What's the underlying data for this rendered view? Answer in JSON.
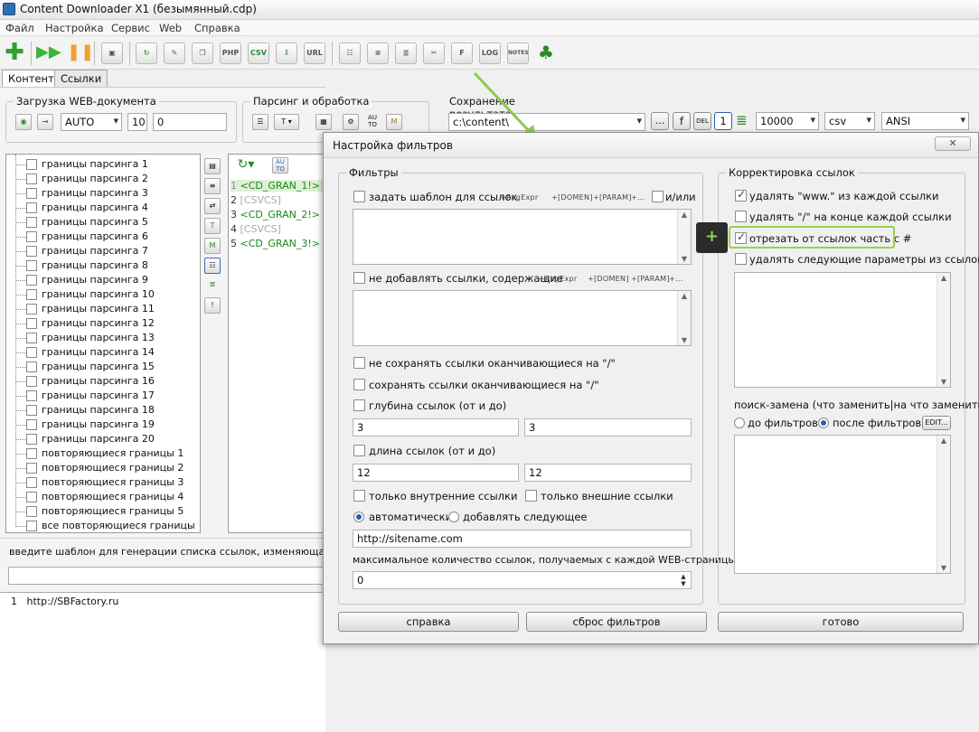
{
  "window": {
    "title": "Content Downloader X1 (безымянный.cdp)"
  },
  "menu": [
    "Файл",
    "Настройка",
    "Сервис",
    "Web",
    "Справка"
  ],
  "toolbar": {
    "icon_labels": [
      "PHP",
      "CSV",
      "URL",
      "LOG",
      "NOTES"
    ]
  },
  "tabs": [
    {
      "label": "Контент"
    },
    {
      "label": "Ссылки"
    }
  ],
  "load_group": {
    "title": "Загрузка WEB-документа",
    "mode": "AUTO",
    "threads": "10",
    "delay": "0"
  },
  "parse_group": {
    "title": "Парсинг и обработка"
  },
  "save_group": {
    "title": "Сохранение результата",
    "path": "c:\\content\\",
    "browse_label": "...",
    "f_label": "f",
    "del_label": "DEL",
    "one_label": "1",
    "limit": "10000",
    "format": "csv",
    "encoding": "ANSI"
  },
  "tree": {
    "items": [
      "границы парсинга 1",
      "границы парсинга 2",
      "границы парсинга 3",
      "границы парсинга 4",
      "границы парсинга 5",
      "границы парсинга 6",
      "границы парсинга 7",
      "границы парсинга 8",
      "границы парсинга 9",
      "границы парсинга 10",
      "границы парсинга 11",
      "границы парсинга 12",
      "границы парсинга 13",
      "границы парсинга 14",
      "границы парсинга 15",
      "границы парсинга 16",
      "границы парсинга 17",
      "границы парсинга 18",
      "границы парсинга 19",
      "границы парсинга 20",
      "повторяющиеся границы 1",
      "повторяющиеся границы 2",
      "повторяющиеся границы 3",
      "повторяющиеся границы 4",
      "повторяющиеся границы 5",
      "все повторяющиеся границы"
    ]
  },
  "code": {
    "auto_label": "AU TO",
    "lines": [
      {
        "n": "1",
        "text": "<CD_GRAN_1!> (",
        "c": "#1a8a1a"
      },
      {
        "n": "2",
        "text": "[CSVCS]",
        "c": "#aaaaaa"
      },
      {
        "n": "3",
        "text": "<CD_GRAN_2!> (",
        "c": "#1a8a1a"
      },
      {
        "n": "4",
        "text": "[CSVCS]",
        "c": "#aaaaaa"
      },
      {
        "n": "5",
        "text": "<CD_GRAN_3!> (",
        "c": "#1a8a1a"
      }
    ]
  },
  "vtools": {
    "t_label": "T",
    "m_label": "M",
    "bang_label": "!"
  },
  "parse_tools": {
    "t_label": "T",
    "au_label": "AU TO",
    "m_label": "M"
  },
  "hint": "введите шаблон для генерации списка ссылок, изменяющаяся част",
  "links": [
    {
      "n": "1",
      "url": "http://SBFactory.ru"
    }
  ],
  "dialog": {
    "title": "Настройка фильтров",
    "close_label": "",
    "filters": {
      "title": "Фильтры",
      "template_label": "задать шаблон для ссылок",
      "tokens1": [
        "+RegExpr",
        "+[DOMEN]",
        "+[PARAM]",
        "+..."
      ],
      "and_or_label": "и/или",
      "not_contain_label": "не добавлять ссылки, содержащие",
      "tokens2": [
        "+RegExpr",
        "+[DOMEN]",
        "+[PARAM]",
        "+..."
      ],
      "not_save_slash": "не сохранять ссылки оканчивающиеся на  \"/\"",
      "save_slash": "сохранять ссылки оканчивающиеся на \"/\"",
      "depth_label": "глубина ссылок (от и до)",
      "depth_from": "3",
      "depth_to": "3",
      "length_label": "длина ссылок (от и до)",
      "length_from": "12",
      "length_to": "12",
      "internal_label": "только внутренние ссылки",
      "external_label": "только внешние ссылки",
      "auto_label": "автоматически",
      "add_next_label": "добавлять следующее",
      "site_value": "http://sitename.com",
      "max_label": "максимальное количество ссылок, получаемых с каждой WEB-страницы",
      "max_value": "0"
    },
    "correction": {
      "title": "Корректировка ссылок",
      "remove_www": "удалять \"www.\" из каждой ссылки",
      "remove_slash": "удалять \"/\" на конце каждой ссылки",
      "cut_hash": "отрезать от ссылок часть с #",
      "remove_params": "удалять следующие параметры из ссылок",
      "search_replace_label": "поиск-замена (что заменить|на что заменить)",
      "before_label": "до фильтров",
      "after_label": "после фильтров",
      "edit_label": "EDIT..."
    },
    "plus_label": "+",
    "buttons": {
      "help": "справка",
      "reset": "сброс фильтров",
      "done": "готово"
    }
  }
}
